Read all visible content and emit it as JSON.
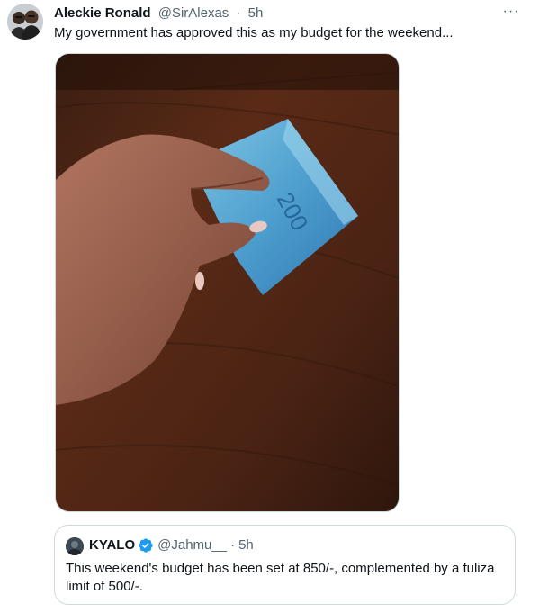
{
  "tweet": {
    "author_name": "Aleckie Ronald",
    "author_handle": "@SirAlexas",
    "separator": "·",
    "time": "5h",
    "more_label": "···",
    "text": "My government has approved this as my budget for the weekend..."
  },
  "quote": {
    "author_name": "KYALO",
    "author_handle": "@Jahmu__",
    "separator": "·",
    "time": "5h",
    "text": "This weekend's budget has been set at 850/-, complemented by a fuliza limit of 500/-."
  },
  "icons": {
    "more": "more-options-icon",
    "verified": "verified-badge-icon"
  },
  "colors": {
    "text_primary": "#0f1419",
    "text_secondary": "#536471",
    "border": "#cfd9de",
    "verified_blue": "#1d9bf0"
  }
}
